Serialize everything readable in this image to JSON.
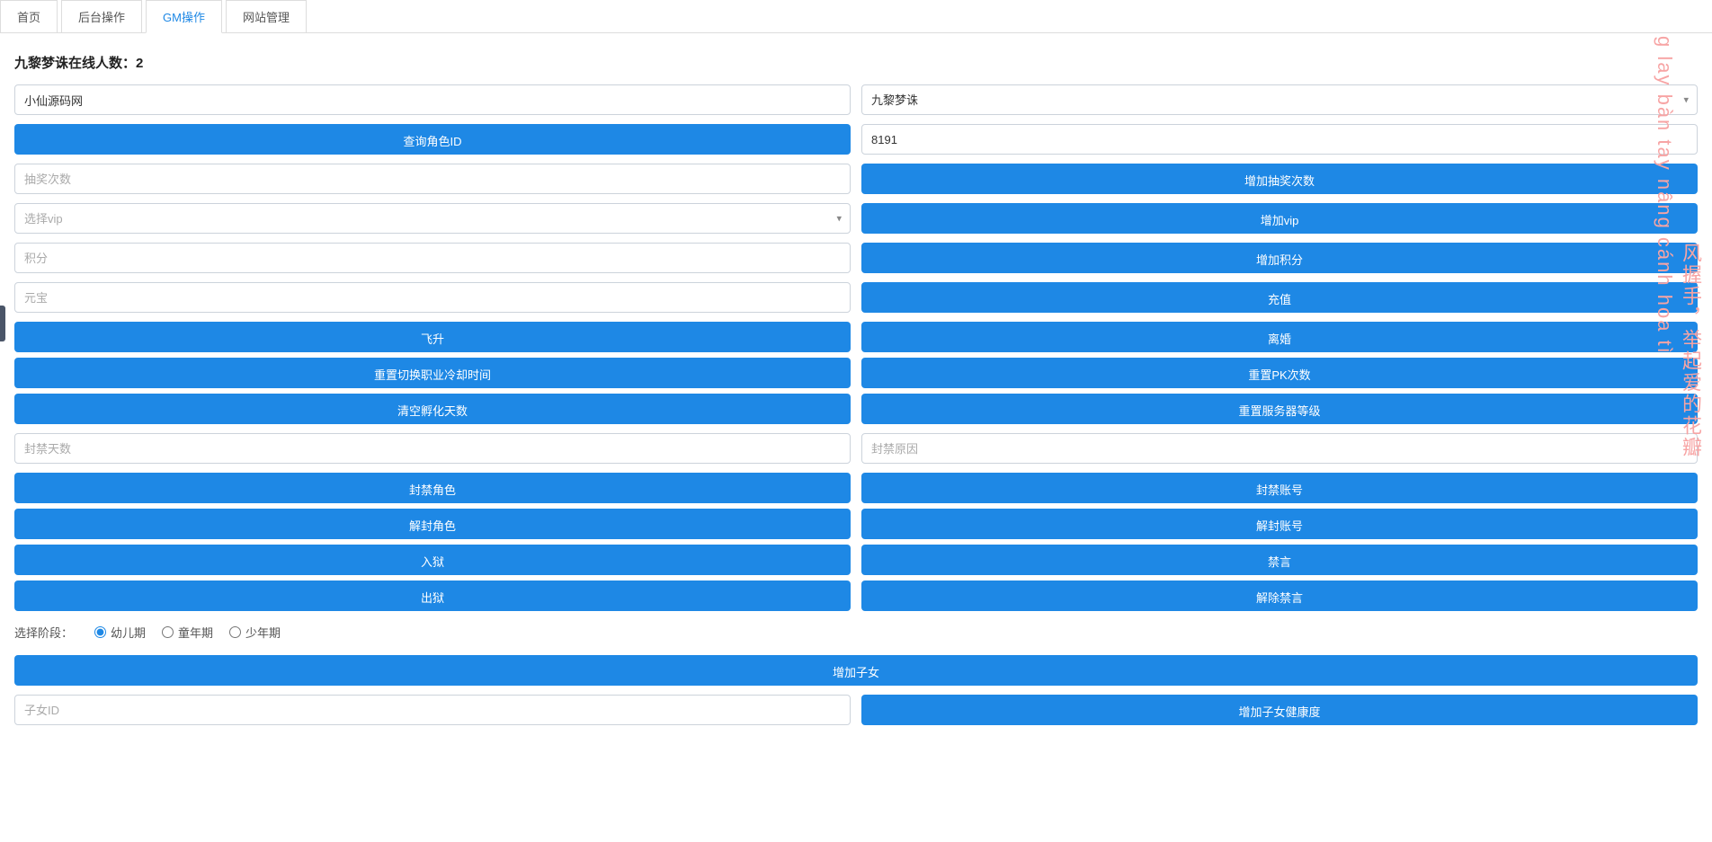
{
  "tabs": {
    "home": "首页",
    "backend": "后台操作",
    "gm": "GM操作",
    "site": "网站管理"
  },
  "title_prefix": "九黎梦诛在线人数：",
  "title_count": "2",
  "account_value": "小仙源码网",
  "server_value": "九黎梦诛",
  "query_role_btn": "查询角色ID",
  "role_id_value": "8191",
  "draw_placeholder": "抽奖次数",
  "add_draw_btn": "增加抽奖次数",
  "vip_placeholder": "选择vip",
  "add_vip_btn": "增加vip",
  "points_placeholder": "积分",
  "add_points_btn": "增加积分",
  "yuanbao_placeholder": "元宝",
  "recharge_btn": "充值",
  "ascend_btn": "飞升",
  "divorce_btn": "离婚",
  "reset_job_cd_btn": "重置切换职业冷却时间",
  "reset_pk_btn": "重置PK次数",
  "clear_hatch_btn": "清空孵化天数",
  "reset_server_level_btn": "重置服务器等级",
  "ban_days_placeholder": "封禁天数",
  "ban_reason_placeholder": "封禁原因",
  "ban_role_btn": "封禁角色",
  "ban_account_btn": "封禁账号",
  "unban_role_btn": "解封角色",
  "unban_account_btn": "解封账号",
  "jail_btn": "入狱",
  "mute_btn": "禁言",
  "unjail_btn": "出狱",
  "unmute_btn": "解除禁言",
  "stage_label": "选择阶段：",
  "stage_opts": {
    "infant": "幼儿期",
    "child": "童年期",
    "teen": "少年期"
  },
  "add_child_btn": "增加子女",
  "child_id_placeholder": "子女ID",
  "add_child_health_btn": "增加子女健康度",
  "deco1": "风握手，举起爱的花瓣",
  "deco2": "g lay bàn tay nâng cánh hoa tì"
}
